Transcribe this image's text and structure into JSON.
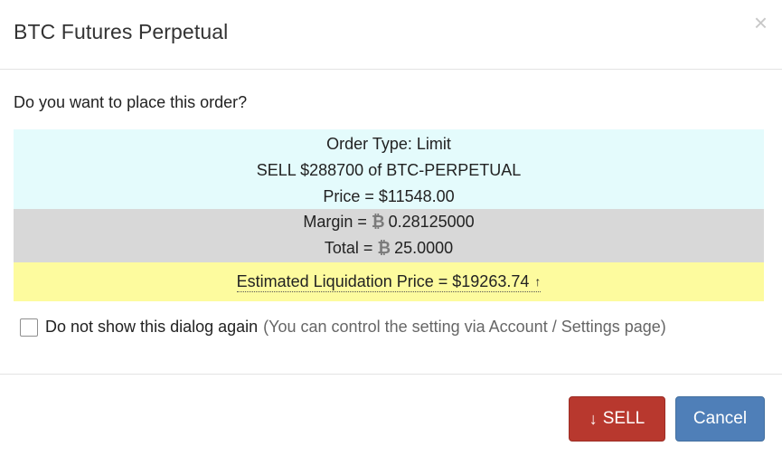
{
  "dialog": {
    "title": "BTC Futures Perpetual",
    "close_glyph": "×",
    "question": "Do you want to place this order?"
  },
  "summary": {
    "order_type": "Order Type: Limit",
    "order_desc": "SELL $288700 of BTC-PERPETUAL",
    "price": "Price = $11548.00",
    "margin_label": "Margin =",
    "margin_value": "0.28125000",
    "total_label": "Total =",
    "total_value": "25.0000",
    "btc_symbol": "₿",
    "liquidation": "Estimated Liquidation Price = $19263.74",
    "liquidation_arrow": "↑"
  },
  "checkbox": {
    "label": "Do not show this dialog again",
    "hint": "(You can control the setting via Account / Settings page)"
  },
  "buttons": {
    "sell_label": "SELL",
    "sell_icon": "↓",
    "cancel_label": "Cancel"
  },
  "colors": {
    "cyan_block": "#e4fbfc",
    "grey_block": "#d8d8d8",
    "yellow_block": "#fdfb9e",
    "sell_button": "#b8382e",
    "cancel_button": "#4f7fb8"
  }
}
